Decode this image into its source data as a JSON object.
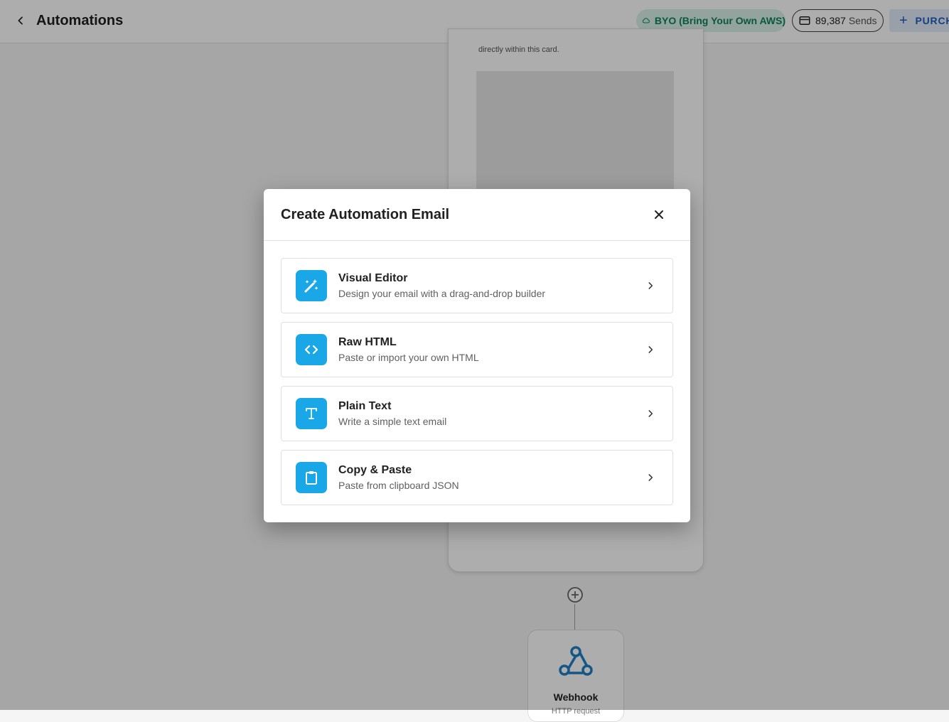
{
  "header": {
    "title": "Automations",
    "byo_label": "BYO (Bring Your Own AWS)",
    "sends_count": "89,387",
    "sends_unit": "Sends",
    "purchase_label": "PURCHASE"
  },
  "canvas": {
    "email_card_note": "directly within this card.",
    "webhook_label": "Webhook",
    "webhook_sub": "HTTP request"
  },
  "dialog": {
    "title": "Create Automation Email",
    "options": [
      {
        "title": "Visual Editor",
        "description": "Design your email with a drag-and-drop builder",
        "icon": "magic-wand-icon"
      },
      {
        "title": "Raw HTML",
        "description": "Paste or import your own HTML",
        "icon": "code-icon"
      },
      {
        "title": "Plain Text",
        "description": "Write a simple text email",
        "icon": "text-icon"
      },
      {
        "title": "Copy & Paste",
        "description": "Paste from clipboard JSON",
        "icon": "clipboard-icon"
      }
    ]
  },
  "colors": {
    "accent": "#1aa7e8",
    "byo_bg": "#d9f0e8",
    "byo_text": "#10825e",
    "purchase_text": "#1e5fbf"
  }
}
